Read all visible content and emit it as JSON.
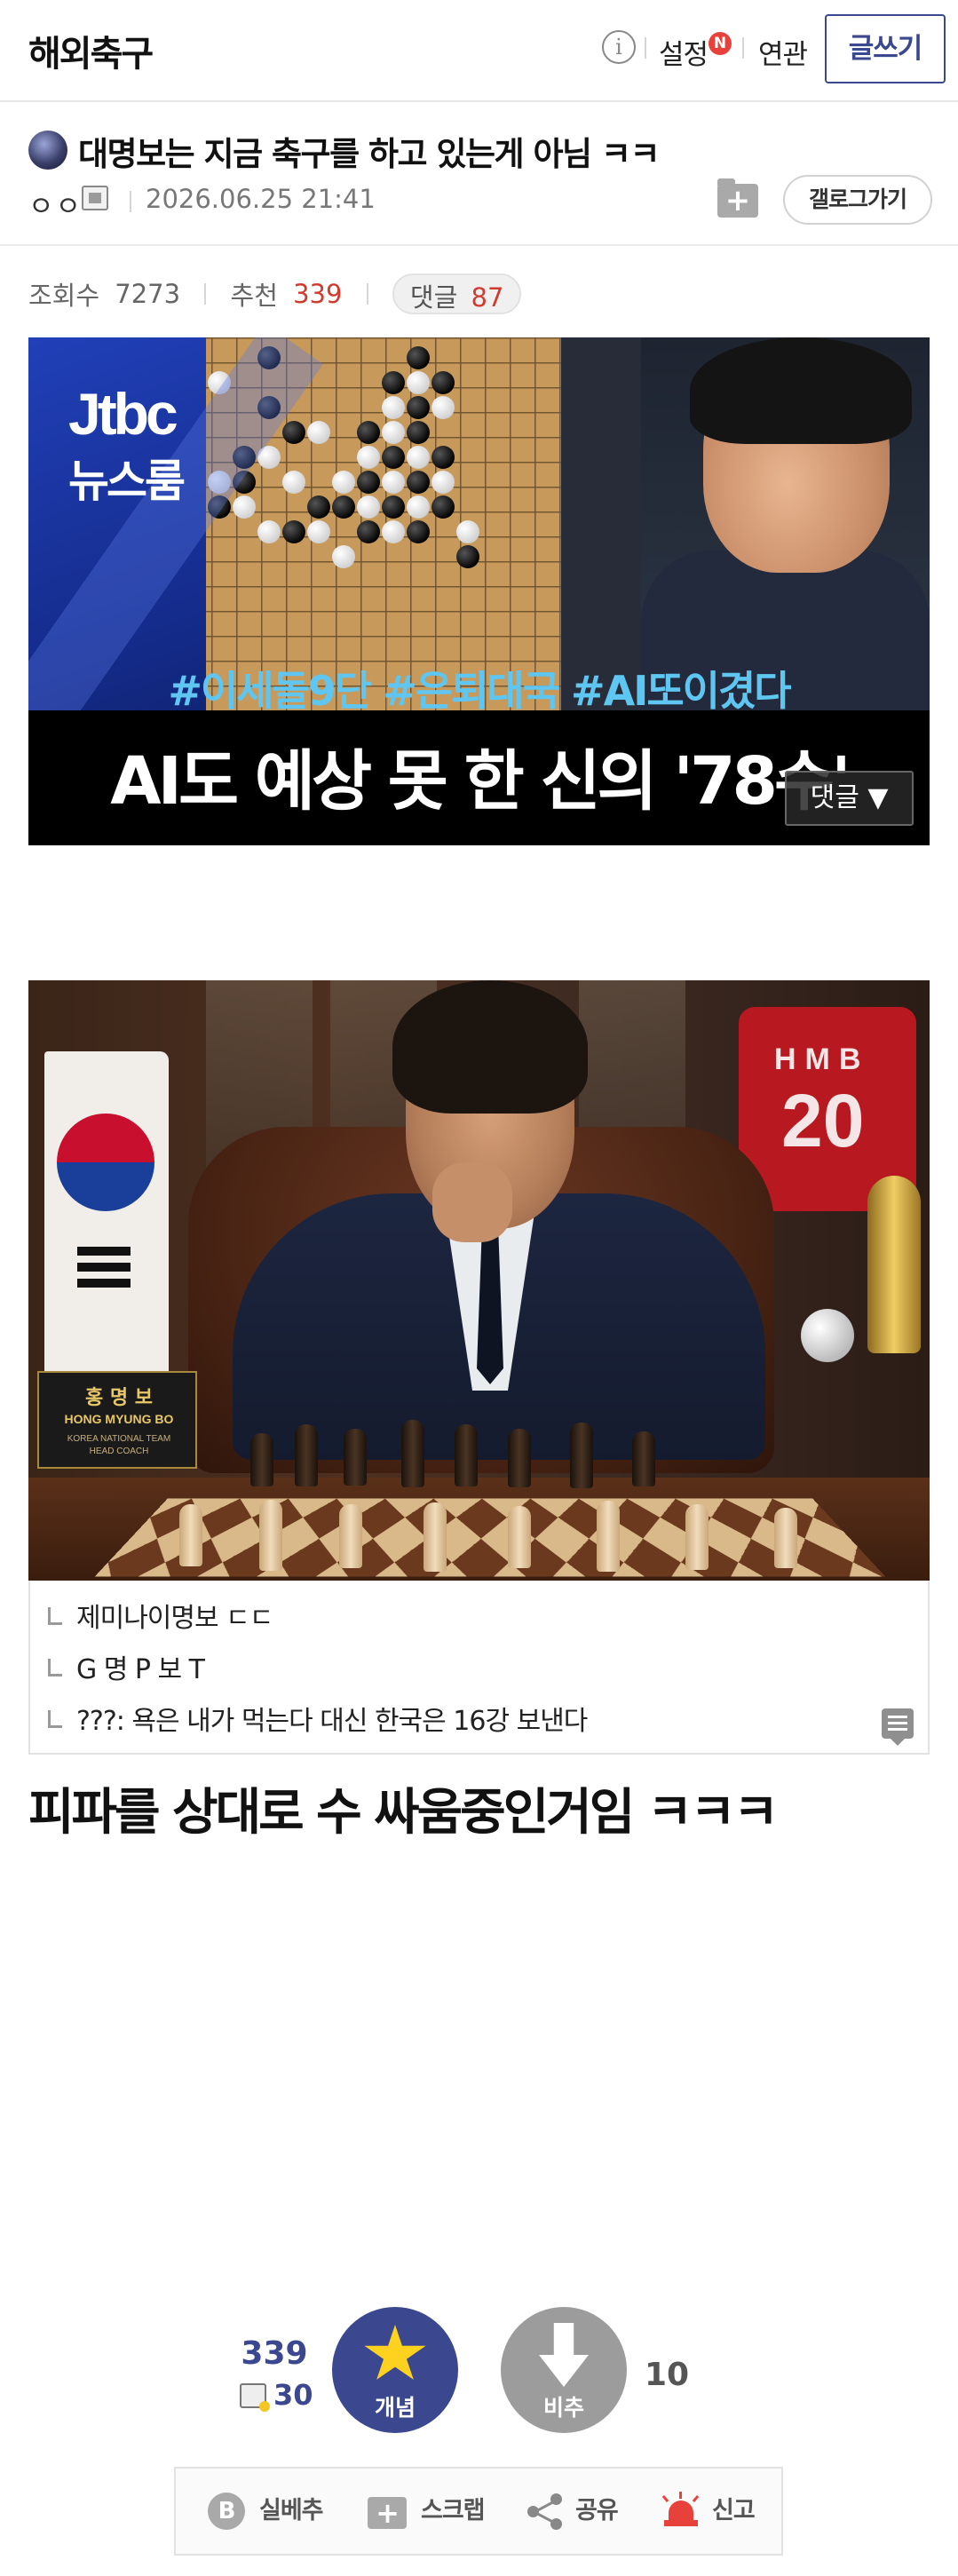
{
  "header": {
    "gallery_name": "해외축구",
    "info_icon": "i",
    "setting_label": "설정",
    "new_badge": "N",
    "related_label": "연관",
    "write_label": "글쓰기"
  },
  "post": {
    "title": "대명보는 지금 축구를 하고 있는게 아님 ㅋㅋ",
    "author_nick": "ㅇㅇ",
    "date": "2026.06.25 21:41",
    "gallog_label": "갤로그가기"
  },
  "stats": {
    "views_label": "조회수",
    "views": "7273",
    "recommend_label": "추천",
    "recommend": "339",
    "comments_label": "댓글",
    "comments": "87"
  },
  "image1": {
    "logo": "Jtbc",
    "logo_sub": "뉴스룸",
    "hashtags": "#이세돌9단 #은퇴대국 #AI또이겼다",
    "caption": "AI도 예상 못 한 신의 '78수'",
    "comment_button": "댓글 ▼"
  },
  "image2": {
    "nameplate_kr": "홍 명 보",
    "nameplate_en": "HONG MYUNG BO",
    "nameplate_sub1": "KOREA NATIONAL TEAM",
    "nameplate_sub2": "HEAD COACH",
    "jersey_letters": "HMB",
    "jersey_number": "20"
  },
  "related_comments": [
    "제미나이명보 ㄷㄷ",
    "G 명 P 보 T",
    "???: 욕은 내가 먹는다 대신 한국은 16강 보낸다"
  ],
  "body_text": "피파를 상대로 수 싸움중인거임 ㅋㅋㅋ",
  "votes": {
    "up_count": "339",
    "fix_count": "30",
    "up_label": "개념",
    "down_label": "비추",
    "down_count": "10"
  },
  "actions": {
    "silbe_label": "실베추",
    "silbe_icon_letter": "B",
    "scrap_label": "스크랩",
    "share_label": "공유",
    "report_label": "신고"
  },
  "colors": {
    "brand": "#3b4890",
    "accent_red": "#d13b2f",
    "badge_red": "#e8413c"
  }
}
